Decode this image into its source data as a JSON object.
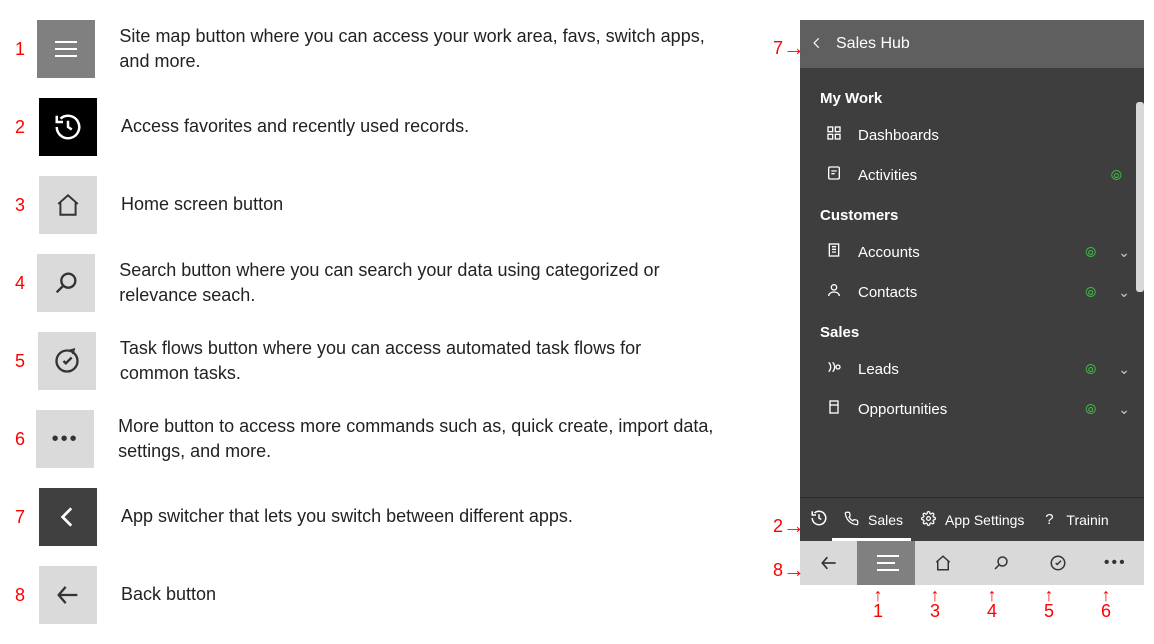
{
  "legend": {
    "items": [
      {
        "num": "1",
        "desc": "Site map button where you can access your work area, favs, switch apps, and more."
      },
      {
        "num": "2",
        "desc": "Access favorites and recently used records."
      },
      {
        "num": "3",
        "desc": "Home screen button"
      },
      {
        "num": "4",
        "desc": "Search button where you can search your data using categorized or relevance seach."
      },
      {
        "num": "5",
        "desc": "Task flows button where you can access automated task flows for common tasks."
      },
      {
        "num": "6",
        "desc": "More button to access more commands such as, quick create, import data, settings, and more."
      },
      {
        "num": "7",
        "desc": "App switcher that lets you switch between different apps."
      },
      {
        "num": "8",
        "desc": "Back button"
      }
    ]
  },
  "app": {
    "header_title": "Sales Hub",
    "sections": [
      {
        "title": "My Work",
        "items": [
          {
            "icon": "dashboard-icon",
            "label": "Dashboards",
            "wifi": false,
            "expandable": false
          },
          {
            "icon": "activities-icon",
            "label": "Activities",
            "wifi": true,
            "expandable": false
          }
        ]
      },
      {
        "title": "Customers",
        "items": [
          {
            "icon": "accounts-icon",
            "label": "Accounts",
            "wifi": true,
            "expandable": true
          },
          {
            "icon": "contacts-icon",
            "label": "Contacts",
            "wifi": true,
            "expandable": true
          }
        ]
      },
      {
        "title": "Sales",
        "items": [
          {
            "icon": "leads-icon",
            "label": "Leads",
            "wifi": true,
            "expandable": true
          },
          {
            "icon": "opportunities-icon",
            "label": "Opportunities",
            "wifi": true,
            "expandable": true
          }
        ]
      }
    ],
    "area_bar": {
      "recent_icon": "recent-icon",
      "items": [
        {
          "icon": "phone-icon",
          "label": "Sales",
          "selected": true
        },
        {
          "icon": "gear-icon",
          "label": "App Settings",
          "selected": false
        },
        {
          "icon": "help-icon",
          "label": "Trainin",
          "selected": false
        }
      ]
    },
    "bottom_bar": {
      "cells": [
        {
          "name": "back-button",
          "num": "8"
        },
        {
          "name": "sitemap-button",
          "num": "1"
        },
        {
          "name": "home-button",
          "num": "3"
        },
        {
          "name": "search-button",
          "num": "4"
        },
        {
          "name": "taskflow-button",
          "num": "5"
        },
        {
          "name": "more-button",
          "num": "6"
        }
      ]
    }
  },
  "side_callouts": {
    "c7": "7",
    "c2": "2",
    "c8": "8"
  },
  "bottom_callouts": [
    "1",
    "3",
    "4",
    "5",
    "6"
  ]
}
